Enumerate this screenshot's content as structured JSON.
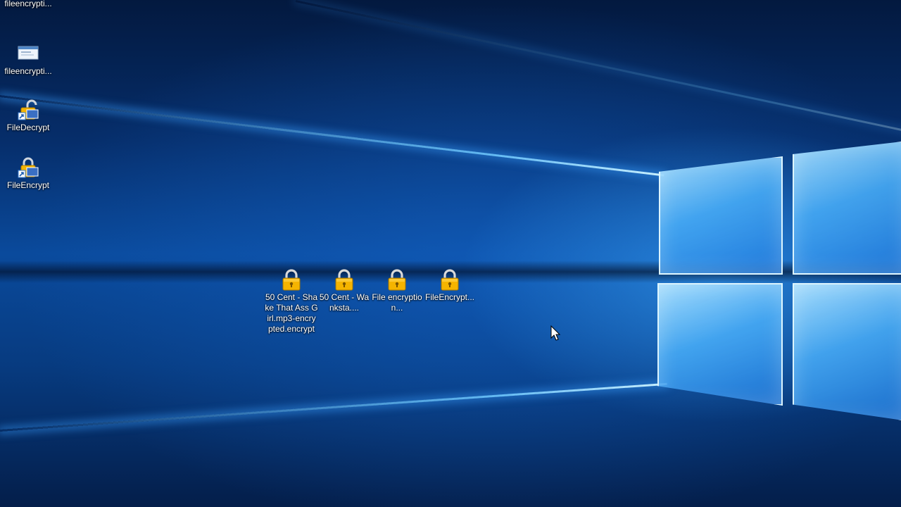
{
  "desktop": {
    "left_icons": [
      {
        "label": "fileencrypti...",
        "icon": "document-icon"
      },
      {
        "label": "fileencrypti...",
        "icon": "window-preview-icon"
      },
      {
        "label": "FileDecrypt",
        "icon": "unlock-shortcut-icon"
      },
      {
        "label": "FileEncrypt",
        "icon": "lock-shortcut-icon"
      }
    ],
    "encrypted_files": [
      {
        "label": "50 Cent - Shake That Ass Girl.mp3-encrypted.encrypt",
        "icon": "padlock-icon"
      },
      {
        "label": "50 Cent - Wanksta....",
        "icon": "padlock-icon"
      },
      {
        "label": "File encryption...",
        "icon": "padlock-icon"
      },
      {
        "label": "FileEncrypt...",
        "icon": "padlock-icon"
      }
    ],
    "colors": {
      "background_dark": "#03193f",
      "background_mid": "#0a4a9c",
      "logo_glow": "#6ec8ff",
      "padlock_gold": "#f5b400"
    }
  }
}
